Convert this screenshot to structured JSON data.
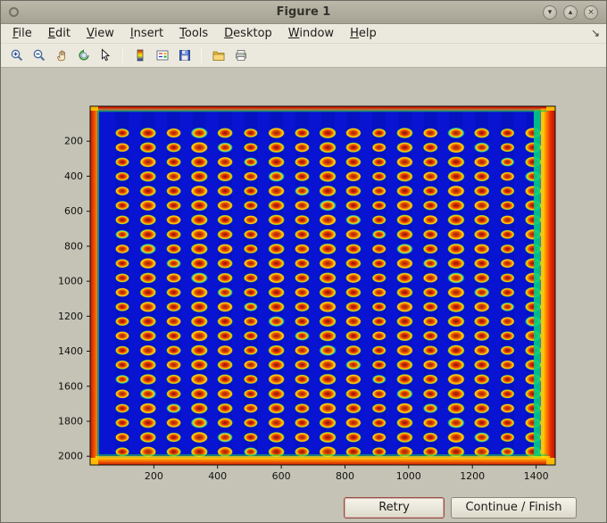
{
  "window": {
    "title": "Figure 1",
    "controls": {
      "minimize": "▾",
      "maximize": "▴",
      "close": "×"
    }
  },
  "menubar": {
    "items": [
      "File",
      "Edit",
      "View",
      "Insert",
      "Tools",
      "Desktop",
      "Window",
      "Help"
    ],
    "dock_glyph": "↘"
  },
  "toolbar": {
    "groups": [
      [
        "zoom-in",
        "zoom-out",
        "pan",
        "rotate-3d",
        "data-cursor"
      ],
      [
        "colorbar",
        "insert-legend",
        "save"
      ],
      [
        "open",
        "print"
      ]
    ]
  },
  "plot": {
    "type": "pseudocolor-image",
    "description": "Thermal/jet colormap image of a microplate: grid of red-yellow spots on blue field with red-orange hot edges",
    "x_ticks": [
      200,
      400,
      600,
      800,
      1000,
      1200,
      1400
    ],
    "y_ticks": [
      200,
      400,
      600,
      800,
      1000,
      1200,
      1400,
      1600,
      1800,
      2000
    ],
    "x_range": [
      0,
      1460
    ],
    "y_range": [
      0,
      2050
    ],
    "grid": {
      "cols": 17,
      "rows": 23,
      "x0": 101,
      "dx": 80.6,
      "y0": 153,
      "dy": 82.8,
      "dot_rx": 25,
      "dot_ry": 29.5
    },
    "colors": {
      "field": "#0814d2",
      "stripe": "#000a78",
      "dot_core": "#8a1400",
      "dot_mid": "#d43000",
      "dot_ring": "#ffd000",
      "dot_halo": "#7cd438",
      "dot_halo_cyan": "#30d8a0",
      "edge_red": "#cc1c00",
      "edge_orange": "#ff8800",
      "edge_yellow": "#ffd800",
      "edge_green": "#22c648",
      "edge_cyan": "#00cc86",
      "tick": "#111111"
    }
  },
  "buttons": {
    "retry_label": "Retry",
    "continue_label": "Continue / Finish"
  }
}
